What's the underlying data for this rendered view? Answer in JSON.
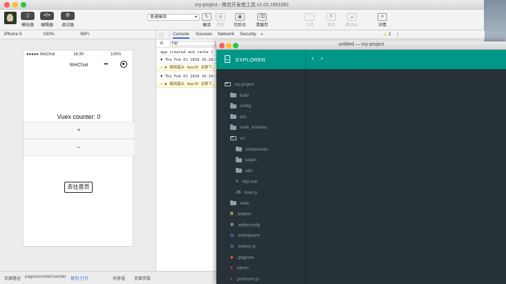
{
  "devtools": {
    "window_title": "my-project - 微信开发者工具 v1.02.1801081",
    "toolbar": {
      "simulator_label": "模拟器",
      "editor_label": "编辑器",
      "debugger_label": "调试器",
      "compile_mode": "普通编译",
      "compile_label": "编译",
      "preview_label": "预览",
      "backend_label": "切后台",
      "clear_cache_label": "清缓存",
      "upload_label": "上传",
      "test_label": "测试",
      "remote_debug_label": "腾讯云",
      "details_label": "详情"
    },
    "device_bar": {
      "device": "iPhone 5",
      "zoom": "100%",
      "network": "WiFi"
    },
    "phone": {
      "carrier": "●●●●● WeChat",
      "time": "18:30",
      "battery": "100%",
      "nav_title": "WeChat",
      "counter_label": "Vuex counter: 0",
      "increment": "+",
      "decrement": "−",
      "go_home": "去往首页"
    },
    "bottom_bar": {
      "page_path_label": "页面路径",
      "page_path": "pages/counter/counter",
      "copy": "复制",
      "open": "打开",
      "scene": "场景值",
      "page_params": "页面参数"
    },
    "console": {
      "tabs": [
        "Console",
        "Sources",
        "Network",
        "Security",
        "»"
      ],
      "warning_count": "2",
      "context": "top",
      "lines": [
        {
          "type": "log",
          "text": "app created and cache l"
        },
        {
          "type": "log",
          "text": "▼ Thu Feb 01 2018 16:20:4"
        },
        {
          "type": "warn",
          "text": "⚠ ▶ 缩用基从 AppID 关联下,"
        },
        {
          "type": "log",
          "text": "▼ Thu Feb 01 2018 16:20:4"
        },
        {
          "type": "warn",
          "text": "⚠ ▶ 缩用基从 AppID 关联下,"
        }
      ]
    }
  },
  "explorer": {
    "window_title": "untitled — my-project",
    "header_title": "EXPLORER",
    "nav_back": "‹",
    "nav_forward": "›",
    "tree": [
      {
        "name": "my-project",
        "kind": "folder-open",
        "depth": 0
      },
      {
        "name": "build",
        "kind": "folder",
        "depth": 1
      },
      {
        "name": "config",
        "kind": "folder",
        "depth": 1
      },
      {
        "name": "dist",
        "kind": "folder",
        "depth": 1
      },
      {
        "name": "node_modules",
        "kind": "folder",
        "depth": 1
      },
      {
        "name": "src",
        "kind": "folder-open",
        "depth": 1
      },
      {
        "name": "components",
        "kind": "folder",
        "depth": 2
      },
      {
        "name": "pages",
        "kind": "folder",
        "depth": 2
      },
      {
        "name": "utils",
        "kind": "folder",
        "depth": 2
      },
      {
        "name": "App.vue",
        "kind": "vue",
        "depth": 2
      },
      {
        "name": "main.js",
        "kind": "js",
        "depth": 2
      },
      {
        "name": "static",
        "kind": "folder",
        "depth": 1
      },
      {
        "name": ".babelrc",
        "kind": "babel",
        "depth": 1
      },
      {
        "name": ".editorconfig",
        "kind": "editorconfig",
        "depth": 1
      },
      {
        "name": ".eslintignore",
        "kind": "eslint",
        "depth": 1
      },
      {
        "name": ".eslintrc.js",
        "kind": "eslint",
        "depth": 1
      },
      {
        "name": ".gitignore",
        "kind": "git",
        "depth": 1
      },
      {
        "name": ".npmrc",
        "kind": "npm",
        "depth": 1
      },
      {
        "name": ".postcssrc.js",
        "kind": "postcss",
        "depth": 1
      }
    ]
  },
  "colors": {
    "explorer_header": "#009688",
    "explorer_bg": "#263238"
  }
}
